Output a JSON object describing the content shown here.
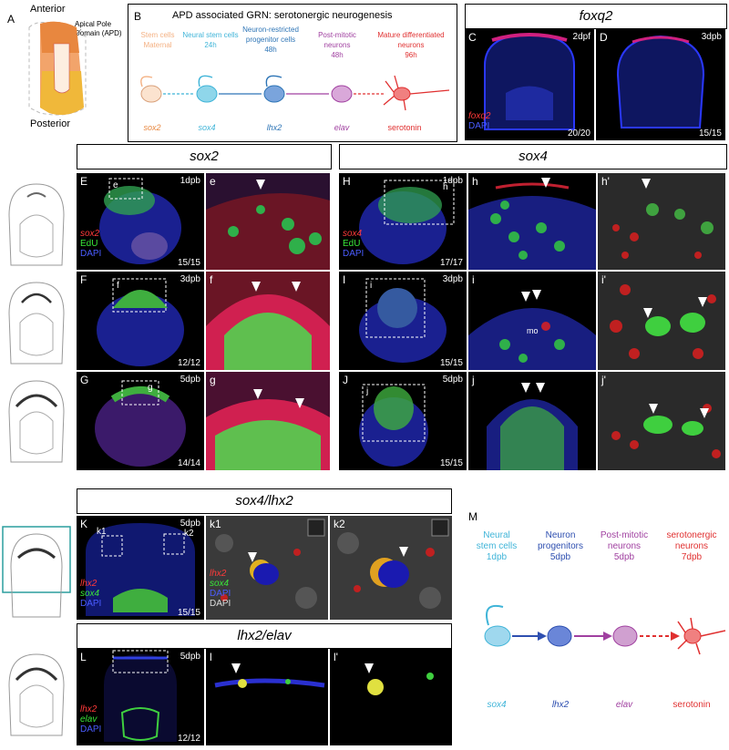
{
  "panelA": {
    "letter": "A",
    "anterior": "Anterior",
    "posterior": "Posterior",
    "apd": "Apical Pole Domain (APD)"
  },
  "panelB": {
    "letter": "B",
    "title": "APD associated GRN: serotonergic neurogenesis",
    "stages": [
      {
        "line1": "Stem cells",
        "line2": "Maternal",
        "gene": "sox2",
        "color": "#f4b183"
      },
      {
        "line1": "Neural stem cells",
        "line2": "24h",
        "gene": "sox4",
        "color": "#3fb4d8"
      },
      {
        "line1": "Neuron-restricted progenitor cells",
        "line2": "48h",
        "gene": "lhx2",
        "color": "#2e75b6"
      },
      {
        "line1": "Post-mitotic neurons",
        "line2": "48h",
        "gene": "elav",
        "color": "#a040a0"
      },
      {
        "line1": "Mature differentiated neurons",
        "line2": "96h",
        "gene": "serotonin",
        "color": "#e03030"
      }
    ]
  },
  "foxq2": {
    "title": "foxq2",
    "C": {
      "letter": "C",
      "stage": "2dpf",
      "count": "20/20",
      "legend_red": "foxq2",
      "legend_blue": "DAPI"
    },
    "D": {
      "letter": "D",
      "stage": "3dpb",
      "count": "15/15"
    }
  },
  "sox2_header": "sox2",
  "sox4_header": "sox4",
  "sox2_legend": {
    "red": "sox2",
    "green": "EdU",
    "blue": "DAPI"
  },
  "sox4_legend": {
    "red": "sox4",
    "green": "EdU",
    "blue": "DAPI"
  },
  "rows": [
    {
      "main": "E",
      "stage": "1dpb",
      "count": "15/15",
      "inset": "e",
      "zoom": "e",
      "main2": "H",
      "stage2": "1dpb",
      "count2": "17/17",
      "inset2": "h",
      "zoom2": "h",
      "zoom2b": "h'"
    },
    {
      "main": "F",
      "stage": "3dpb",
      "count": "12/12",
      "inset": "f",
      "zoom": "f",
      "main2": "I",
      "stage2": "3dpb",
      "count2": "15/15",
      "inset2": "i",
      "zoom2": "i",
      "zoom2b": "i'",
      "mo": "mo"
    },
    {
      "main": "G",
      "stage": "5dpb",
      "count": "14/14",
      "inset": "g",
      "zoom": "g",
      "main2": "J",
      "stage2": "5dpb",
      "count2": "15/15",
      "inset2": "j",
      "zoom2": "j",
      "zoom2b": "j'"
    }
  ],
  "sox4lhx2": {
    "header": "sox4/lhx2",
    "K": {
      "letter": "K",
      "stage": "5dpb",
      "count": "15/15",
      "k1": "k1",
      "k2": "k2",
      "legend_red": "lhx2",
      "legend_green": "sox4",
      "legend_blue": "DAPI"
    },
    "k1_legend": {
      "red": "lhx2",
      "green": "sox4",
      "blue": "DAPI",
      "grey": "DAPI"
    }
  },
  "lhx2elav": {
    "header": "lhx2/elav",
    "L": {
      "letter": "L",
      "stage": "5dpb",
      "count": "12/12",
      "legend_red": "lhx2",
      "legend_green": "elav",
      "legend_blue": "DAPI"
    },
    "l": "l",
    "l2": "l'"
  },
  "panelM": {
    "letter": "M",
    "stages": [
      {
        "line1": "Neural",
        "line2": "stem cells",
        "line3": "1dpb",
        "gene": "sox4",
        "color": "#3fb4d8"
      },
      {
        "line1": "Neuron",
        "line2": "progenitors",
        "line3": "5dpb",
        "gene": "lhx2",
        "color": "#2e4fb0"
      },
      {
        "line1": "Post-mitotic",
        "line2": "neurons",
        "line3": "5dpb",
        "gene": "elav",
        "color": "#a040a0"
      },
      {
        "line1": "serotonergic",
        "line2": "neurons",
        "line3": "7dpb",
        "gene": "serotonin",
        "color": "#e03030"
      }
    ]
  }
}
